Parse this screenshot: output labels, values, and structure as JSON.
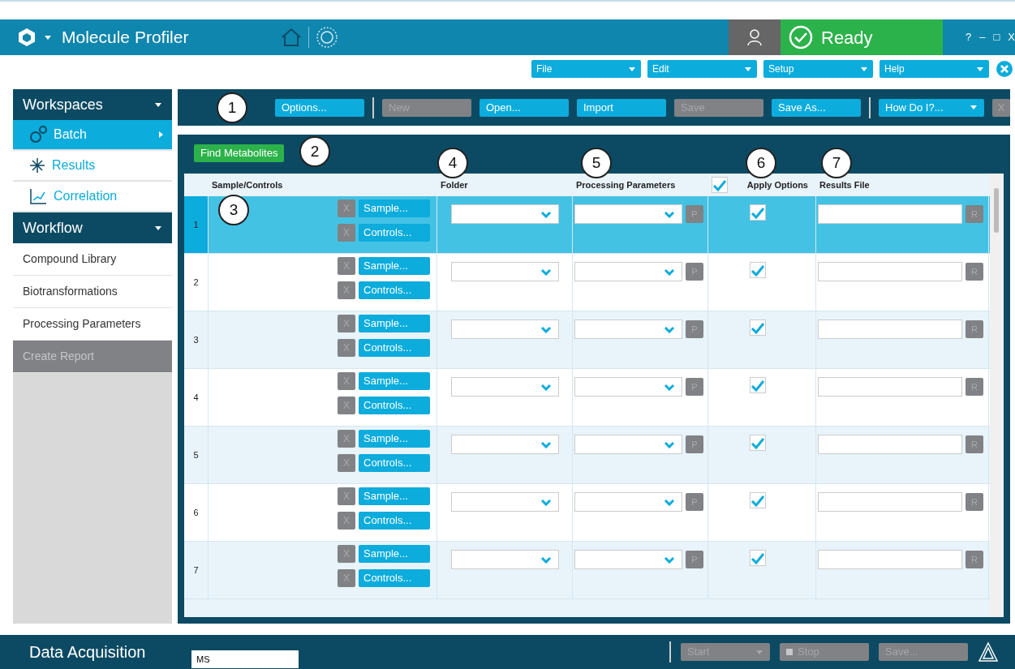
{
  "title_bar": {
    "title": "Molecule Profiler",
    "status": "Ready",
    "window_buttons": [
      "?",
      "–",
      "□",
      "X"
    ]
  },
  "menus": [
    {
      "label": "File"
    },
    {
      "label": "Edit"
    },
    {
      "label": "Setup"
    },
    {
      "label": "Help"
    }
  ],
  "sidebar": {
    "sections": [
      {
        "title": "Workspaces",
        "items": [
          {
            "label": "Batch",
            "selected": true,
            "kind": "batch"
          },
          {
            "label": "Results",
            "selected": false,
            "kind": "results"
          },
          {
            "label": "Correlation",
            "selected": false,
            "kind": "correlation"
          }
        ]
      },
      {
        "title": "Workflow",
        "items": [
          {
            "label": "Compound Library",
            "disabled": false
          },
          {
            "label": "Biotransformations",
            "disabled": false
          },
          {
            "label": "Processing Parameters",
            "disabled": false
          },
          {
            "label": "Create Report",
            "disabled": true
          }
        ]
      }
    ]
  },
  "toolbar": {
    "callout": "1",
    "buttons": [
      {
        "kind": "button",
        "label": "Options...",
        "disabled": false
      },
      {
        "kind": "separator"
      },
      {
        "kind": "button",
        "label": "New",
        "disabled": true
      },
      {
        "kind": "button",
        "label": "Open...",
        "disabled": false
      },
      {
        "kind": "button",
        "label": "Import",
        "disabled": false
      },
      {
        "kind": "button",
        "label": "Save",
        "disabled": true
      },
      {
        "kind": "button",
        "label": "Save As...",
        "disabled": false
      },
      {
        "kind": "separator"
      },
      {
        "kind": "dropdown",
        "label": "How Do I?...",
        "disabled": false
      },
      {
        "kind": "button",
        "label": "X",
        "disabled": true
      }
    ]
  },
  "grid": {
    "action": {
      "label": "Find Metabolites",
      "callout": "2"
    },
    "columns": [
      {
        "label": "Sample/Controls",
        "callout": "3"
      },
      {
        "label": "Folder",
        "callout": "4"
      },
      {
        "label": "Processing Parameters",
        "callout": "5"
      },
      {
        "label": "Apply Options",
        "callout": "6",
        "checked": true
      },
      {
        "label": "Results File",
        "callout": "7"
      }
    ],
    "rows": [
      {
        "number": "1",
        "selected": true,
        "apply": true,
        "clear_sample": "X",
        "sample": "Sample...",
        "clear_controls": "X",
        "controls": "Controls...",
        "params": "P",
        "results": "R"
      },
      {
        "number": "2",
        "selected": false,
        "apply": true,
        "clear_sample": "X",
        "sample": "Sample...",
        "clear_controls": "X",
        "controls": "Controls...",
        "params": "P",
        "results": "R"
      },
      {
        "number": "3",
        "selected": false,
        "apply": true,
        "clear_sample": "X",
        "sample": "Sample...",
        "clear_controls": "X",
        "controls": "Controls...",
        "params": "P",
        "results": "R"
      },
      {
        "number": "4",
        "selected": false,
        "apply": true,
        "clear_sample": "X",
        "sample": "Sample...",
        "clear_controls": "X",
        "controls": "Controls...",
        "params": "P",
        "results": "R"
      },
      {
        "number": "5",
        "selected": false,
        "apply": true,
        "clear_sample": "X",
        "sample": "Sample...",
        "clear_controls": "X",
        "controls": "Controls...",
        "params": "P",
        "results": "R"
      },
      {
        "number": "6",
        "selected": false,
        "apply": true,
        "clear_sample": "X",
        "sample": "Sample...",
        "clear_controls": "X",
        "controls": "Controls...",
        "params": "P",
        "results": "R"
      },
      {
        "number": "7",
        "selected": false,
        "apply": true,
        "clear_sample": "X",
        "sample": "Sample...",
        "clear_controls": "X",
        "controls": "Controls...",
        "params": "P",
        "results": "R"
      }
    ]
  },
  "bottom_bar": {
    "title": "Data Acquisition",
    "field_value": "MS",
    "buttons": [
      {
        "kind": "dropdown",
        "label": "Start",
        "disabled": true
      },
      {
        "kind": "stop",
        "label": "Stop",
        "disabled": true
      },
      {
        "kind": "button",
        "label": "Save...",
        "disabled": true
      }
    ]
  }
}
